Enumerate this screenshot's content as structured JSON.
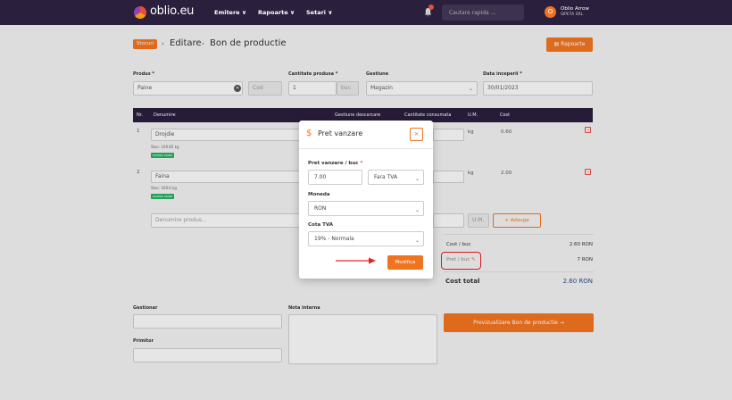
{
  "brand": {
    "name": "oblio.eu"
  },
  "nav": {
    "emitere": "Emitere ∨",
    "rapoarte": "Rapoarte ∨",
    "setari": "Setari ∨"
  },
  "search": {
    "placeholder": "Cautare rapida ..."
  },
  "user": {
    "initial": "O",
    "name": "Oblio Arrow",
    "company": "SIPETA SRL"
  },
  "breadcrumb": {
    "stocuri": "Stocuri",
    "editare": "Editare",
    "page": "Bon de productie"
  },
  "header": {
    "rapoarte_button": "Rapoarte"
  },
  "form": {
    "produs_label": "Produs *",
    "produs_value": "Paine",
    "cod_placeholder": "Cod",
    "cantitate_label": "Cantitate produsa *",
    "cantitate_value": "1",
    "unit": "buc",
    "gestiune_label": "Gestiune",
    "gestiune_value": "Magazin",
    "data_label": "Data inceperii *",
    "data_value": "30/01/2023"
  },
  "table": {
    "headers": [
      "Nr.",
      "Denumire",
      "Gestiune descarcare",
      "Cantitate consumata",
      "U.M.",
      "Cost"
    ],
    "rows": [
      {
        "nr": "1",
        "denumire": "Drojdie",
        "stoc": "Stoc: 109.85 kg",
        "badge": "MATERII PRIME",
        "um": "kg",
        "cost": "0.60"
      },
      {
        "nr": "2",
        "denumire": "Faina",
        "stoc": "Stoc: 109.6 kg",
        "badge": "MATERII PRIME",
        "um": "kg",
        "cost": "2.00"
      }
    ],
    "new_row_placeholder": "Denumire produs...",
    "new_row_um": "U.M.",
    "adauga": "Adauga"
  },
  "summary": {
    "cost_buc_label": "Cost / buc",
    "cost_buc_value": "2.60 RON",
    "pret_buc_label": "Pret / buc",
    "pret_buc_value": "7 RON",
    "cost_total_label": "Cost total",
    "cost_total_value": "2.60 RON"
  },
  "footer": {
    "gestionar": "Gestionar",
    "primitor": "Primitor",
    "nota": "Nota interna",
    "preview": "Previzualizare Bon de productie"
  },
  "modal": {
    "title": "Pret vanzare",
    "pret_label": "Pret vanzare / buc",
    "pret_value": "7.00",
    "tva_mode": "Fara TVA",
    "moneda_label": "Moneda",
    "moneda_value": "RON",
    "cota_label": "Cota TVA",
    "cota_value": "19% - Normala",
    "submit": "Modifica"
  },
  "colors": {
    "accent": "#f07420",
    "navbar": "#2a1f3d",
    "annotation": "#e8202a"
  }
}
